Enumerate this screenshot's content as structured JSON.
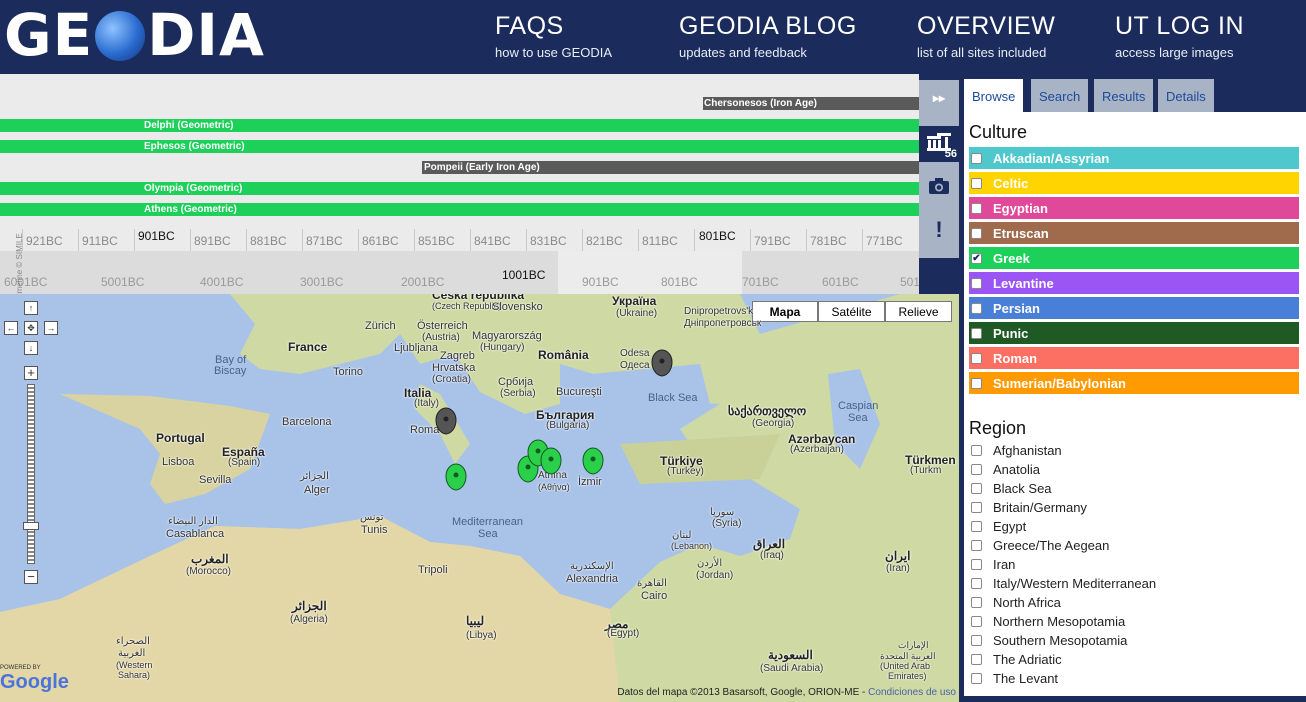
{
  "header": {
    "logo": {
      "left": "GE",
      "right": "DIA"
    },
    "nav": [
      {
        "title": "FAQS",
        "subtitle": "how to use GEODIA"
      },
      {
        "title": "GEODIA BLOG",
        "subtitle": "updates and feedback"
      },
      {
        "title": "OVERVIEW",
        "subtitle": "list of all sites included"
      },
      {
        "title": "UT LOG IN",
        "subtitle": "access large images"
      }
    ]
  },
  "timeline": {
    "bands": [
      {
        "label": "Chersonesos (Iron Age)",
        "color": "gray"
      },
      {
        "label": "Delphi (Geometric)",
        "color": "green"
      },
      {
        "label": "Ephesos (Geometric)",
        "color": "green"
      },
      {
        "label": "Pompeii (Early Iron Age)",
        "color": "gray"
      },
      {
        "label": "Olympia (Geometric)",
        "color": "green"
      },
      {
        "label": "Athens (Geometric)",
        "color": "green"
      }
    ],
    "ticks": [
      "921BC",
      "911BC",
      "901BC",
      "891BC",
      "881BC",
      "871BC",
      "861BC",
      "851BC",
      "841BC",
      "831BC",
      "821BC",
      "811BC",
      "801BC",
      "791BC",
      "781BC",
      "771BC"
    ],
    "overview_ticks": [
      "6001BC",
      "5001BC",
      "4001BC",
      "3001BC",
      "2001BC",
      "1001BC",
      "901BC",
      "801BC",
      "701BC",
      "601BC",
      "501BC"
    ],
    "credit": "Timeline © SIMILE"
  },
  "tools": {
    "sites_count": "56"
  },
  "map": {
    "types": [
      "Mapa",
      "Satélite",
      "Relieve"
    ],
    "labels": [
      "Česká republika",
      "(Czech Republic)",
      "Slovensko",
      "Україна",
      "(Ukraine)",
      "Dnipropetrovs'k",
      "Дніпропетровськ",
      "France",
      "Zürich",
      "Österreich",
      "(Austria)",
      "Magyarország",
      "(Hungary)",
      "Ljubljana",
      "Zagreb",
      "Hrvatska",
      "(Croatia)",
      "România",
      "Odesa",
      "Одеса",
      "Bucureşti",
      "Србија",
      "(Serbia)",
      "Bay of",
      "Biscay",
      "Torino",
      "Italia",
      "(Italy)",
      "България",
      "(Bulgaria)",
      "Black Sea",
      "საქართველო",
      "(Georgia)",
      "Caspian",
      "Sea",
      "Portugal",
      "España",
      "(Spain)",
      "Barcelona",
      "Roma",
      "Azərbaycan",
      "(Azerbaijan)",
      "Türkmen",
      "(Turkm",
      "Lisboa",
      "Sevilla",
      "Türkiye",
      "(Turkey)",
      "Athína",
      "(Αθήνα)",
      "İzmir",
      "Alger",
      "الجزائر",
      "Tunis",
      "تونس",
      "Mediterranean",
      "Sea",
      "سوريا",
      "(Syria)",
      "لبنان",
      "(Lebanon)",
      "العراق",
      "(Iraq)",
      "ایران",
      "(Iran)",
      "الدار البيضاء",
      "Casablanca",
      "المغرب",
      "(Morocco)",
      "Tripoli",
      "Alexandria",
      "الإسكندرية",
      "Cairo",
      "القاهرة",
      "الأردن",
      "(Jordan)",
      "الجزائر",
      "(Algeria)",
      "ليبيا",
      "(Libya)",
      "مصر",
      "(Egypt)",
      "الصحراء",
      "الغربية",
      "(Western",
      "Sahara)",
      "السعودية",
      "(Saudi Arabia)",
      "الإمارات",
      "العربية المتحدة",
      "(United Arab",
      "Emirates)"
    ],
    "copyright": "Datos del mapa ©2013 Basarsoft, Google, ORION-ME",
    "terms_link": "Condiciones de uso",
    "powered_by": "POWERED BY",
    "google": "Google"
  },
  "panel": {
    "tabs": [
      "Browse",
      "Search",
      "Results",
      "Details"
    ],
    "culture_title": "Culture",
    "cultures": [
      {
        "label": "Akkadian/Assyrian",
        "color": "#4ec8cc",
        "checked": false
      },
      {
        "label": "Celtic",
        "color": "#ffd400",
        "checked": false
      },
      {
        "label": "Egyptian",
        "color": "#e0489a",
        "checked": false
      },
      {
        "label": "Etruscan",
        "color": "#a06b4c",
        "checked": false
      },
      {
        "label": "Greek",
        "color": "#1dd05a",
        "checked": true
      },
      {
        "label": "Levantine",
        "color": "#9b55f5",
        "checked": false
      },
      {
        "label": "Persian",
        "color": "#4a7fd8",
        "checked": false
      },
      {
        "label": "Punic",
        "color": "#1f5a24",
        "checked": false
      },
      {
        "label": "Roman",
        "color": "#fb7062",
        "checked": false
      },
      {
        "label": "Sumerian/Babylonian",
        "color": "#ff9a00",
        "checked": false
      }
    ],
    "region_title": "Region",
    "regions": [
      "Afghanistan",
      "Anatolia",
      "Black Sea",
      "Britain/Germany",
      "Egypt",
      "Greece/The Aegean",
      "Iran",
      "Italy/Western Mediterranean",
      "North Africa",
      "Northern Mesopotamia",
      "Southern Mesopotamia",
      "The Adriatic",
      "The Levant"
    ]
  }
}
